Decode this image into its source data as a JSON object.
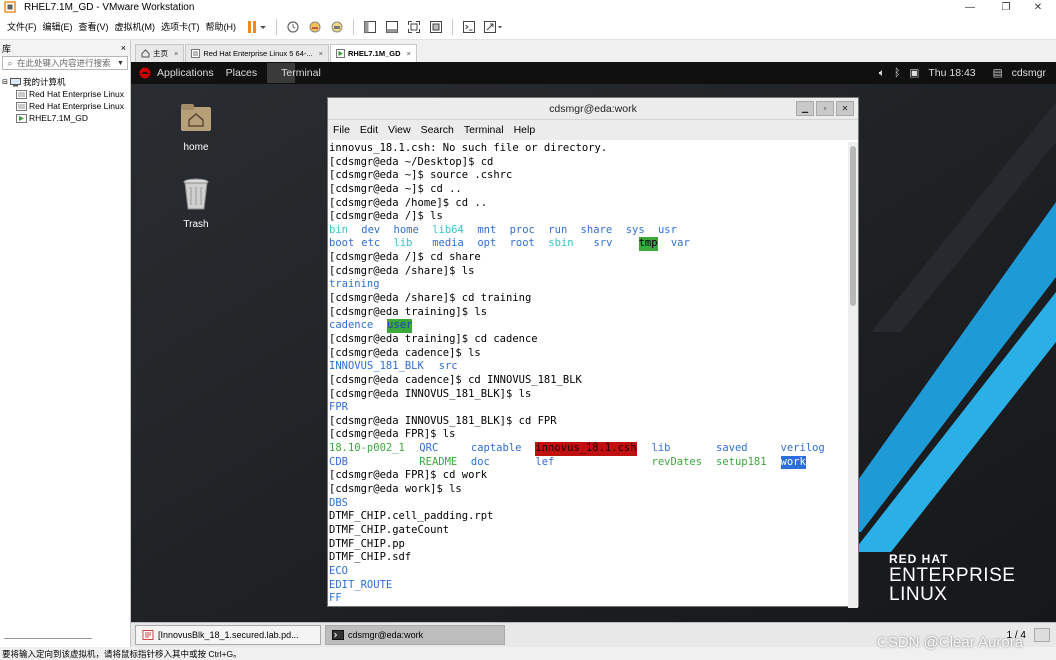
{
  "window": {
    "title": "RHEL7.1M_GD - VMware Workstation"
  },
  "menubar": {
    "items": [
      "文件(F)",
      "编辑(E)",
      "查看(V)",
      "虚拟机(M)",
      "选项卡(T)",
      "帮助(H)"
    ]
  },
  "library": {
    "title": "库",
    "close": "×",
    "search_placeholder": "在此处键入内容进行搜索",
    "tree": [
      {
        "label": "我的计算机",
        "level": 0
      },
      {
        "label": "Red Hat Enterprise Linux",
        "level": 1
      },
      {
        "label": "Red Hat Enterprise Linux",
        "level": 1
      },
      {
        "label": "RHEL7.1M_GD",
        "level": 1
      }
    ]
  },
  "tabs": [
    {
      "label": "主页",
      "active": false
    },
    {
      "label": "Red Hat Enterprise Linux 5 64-...",
      "active": false
    },
    {
      "label": "RHEL7.1M_GD",
      "active": true
    }
  ],
  "tab_close": "×",
  "gnome": {
    "applications": "Applications",
    "places": "Places",
    "terminal": "Terminal",
    "clock": "Thu 18:43",
    "user": "cdsmgr"
  },
  "desktop": {
    "home_label": "home",
    "trash_label": "Trash"
  },
  "branding": {
    "line1": "RED HAT",
    "line2": "ENTERPRISE",
    "line3": "LINUX"
  },
  "terminal": {
    "title": "cdsmgr@eda:work",
    "menu": [
      "File",
      "Edit",
      "View",
      "Search",
      "Terminal",
      "Help"
    ],
    "lines": [
      [
        {
          "t": "innovus_18.1.csh: No such file or directory.",
          "c": 0
        }
      ],
      [
        {
          "t": "[cdsmgr@eda ~/Desktop]$ cd",
          "c": 0
        }
      ],
      [
        {
          "t": "[cdsmgr@eda ~]$ source .cshrc",
          "c": 0
        }
      ],
      [
        {
          "t": "[cdsmgr@eda ~]$ cd ..",
          "c": 0
        }
      ],
      [
        {
          "t": "[cdsmgr@eda /home]$ cd ..",
          "c": 0
        }
      ],
      [
        {
          "t": "[cdsmgr@eda /]$ ls",
          "c": 0
        }
      ],
      [
        {
          "t": "bin",
          "c": 0,
          "k": "lnk"
        },
        {
          "t": "dev",
          "c": 5,
          "k": "dir"
        },
        {
          "t": "home",
          "c": 10,
          "k": "dir"
        },
        {
          "t": "lib64",
          "c": 16,
          "k": "lnk"
        },
        {
          "t": "mnt",
          "c": 23,
          "k": "dir"
        },
        {
          "t": "proc",
          "c": 28,
          "k": "dir"
        },
        {
          "t": "run",
          "c": 34,
          "k": "dir"
        },
        {
          "t": "share",
          "c": 39,
          "k": "dir"
        },
        {
          "t": "sys",
          "c": 46,
          "k": "dir"
        },
        {
          "t": "usr",
          "c": 51,
          "k": "dir"
        }
      ],
      [
        {
          "t": "boot",
          "c": 0,
          "k": "dir"
        },
        {
          "t": "etc",
          "c": 5,
          "k": "dir"
        },
        {
          "t": "lib",
          "c": 10,
          "k": "lnk"
        },
        {
          "t": "media",
          "c": 16,
          "k": "dir"
        },
        {
          "t": "opt",
          "c": 23,
          "k": "dir"
        },
        {
          "t": "root",
          "c": 28,
          "k": "dir"
        },
        {
          "t": "sbin",
          "c": 34,
          "k": "lnk"
        },
        {
          "t": "srv",
          "c": 41,
          "k": "dir"
        },
        {
          "t": "tmp",
          "c": 48,
          "k": "hl-green"
        },
        {
          "t": "var",
          "c": 53,
          "k": "dir"
        }
      ],
      [
        {
          "t": "[cdsmgr@eda /]$ cd share",
          "c": 0
        }
      ],
      [
        {
          "t": "[cdsmgr@eda /share]$ ls",
          "c": 0
        }
      ],
      [
        {
          "t": "training",
          "c": 0,
          "k": "dir"
        }
      ],
      [
        {
          "t": "[cdsmgr@eda /share]$ cd training",
          "c": 0
        }
      ],
      [
        {
          "t": "[cdsmgr@eda training]$ ls",
          "c": 0
        }
      ],
      [
        {
          "t": "cadence",
          "c": 0,
          "k": "dir"
        },
        {
          "t": "user",
          "c": 9,
          "k": "hl-green-blue"
        }
      ],
      [
        {
          "t": "[cdsmgr@eda training]$ cd cadence",
          "c": 0
        }
      ],
      [
        {
          "t": "[cdsmgr@eda cadence]$ ls",
          "c": 0
        }
      ],
      [
        {
          "t": "INNOVUS_181_BLK",
          "c": 0,
          "k": "dir"
        },
        {
          "t": "src",
          "c": 17,
          "k": "dir"
        }
      ],
      [
        {
          "t": "[cdsmgr@eda cadence]$ cd INNOVUS_181_BLK",
          "c": 0
        }
      ],
      [
        {
          "t": "[cdsmgr@eda INNOVUS_181_BLK]$ ls",
          "c": 0
        }
      ],
      [
        {
          "t": "FPR",
          "c": 0,
          "k": "dir"
        }
      ],
      [
        {
          "t": "[cdsmgr@eda INNOVUS_181_BLK]$ cd FPR",
          "c": 0
        }
      ],
      [
        {
          "t": "[cdsmgr@eda FPR]$ ls",
          "c": 0
        }
      ],
      [
        {
          "t": "18.10-p002_1",
          "c": 0,
          "k": "execg"
        },
        {
          "t": "QRC",
          "c": 14,
          "k": "dir"
        },
        {
          "t": "captable",
          "c": 22,
          "k": "dir"
        },
        {
          "t": "innovus_18.1.csh",
          "c": 32,
          "k": "hl-red"
        },
        {
          "t": "lib",
          "c": 50,
          "k": "dir"
        },
        {
          "t": "saved",
          "c": 60,
          "k": "dir"
        },
        {
          "t": "verilog",
          "c": 70,
          "k": "dir"
        }
      ],
      [
        {
          "t": "CDB",
          "c": 0,
          "k": "dir"
        },
        {
          "t": "README",
          "c": 14,
          "k": "execg"
        },
        {
          "t": "doc",
          "c": 22,
          "k": "dir"
        },
        {
          "t": "lef",
          "c": 32,
          "k": "dir"
        },
        {
          "t": "revDates",
          "c": 50,
          "k": "execg"
        },
        {
          "t": "setup181",
          "c": 60,
          "k": "execg"
        },
        {
          "t": "work",
          "c": 70,
          "k": "hl-blue"
        }
      ],
      [
        {
          "t": "[cdsmgr@eda FPR]$ cd work",
          "c": 0
        }
      ],
      [
        {
          "t": "[cdsmgr@eda work]$ ls",
          "c": 0
        }
      ],
      [
        {
          "t": "DBS",
          "c": 0,
          "k": "dir"
        }
      ],
      [
        {
          "t": "DTMF_CHIP.cell_padding.rpt",
          "c": 0
        }
      ],
      [
        {
          "t": "DTMF_CHIP.gateCount",
          "c": 0
        }
      ],
      [
        {
          "t": "DTMF_CHIP.pp",
          "c": 0
        }
      ],
      [
        {
          "t": "DTMF_CHIP.sdf",
          "c": 0
        }
      ],
      [
        {
          "t": "ECO",
          "c": 0,
          "k": "dir"
        }
      ],
      [
        {
          "t": "EDIT_ROUTE",
          "c": 0,
          "k": "dir"
        }
      ],
      [
        {
          "t": "FF",
          "c": 0,
          "k": "dir"
        }
      ]
    ]
  },
  "guest_taskbar": {
    "tasks": [
      {
        "label": "[InnovusBlk_18_1.secured.lab.pd...",
        "active": false
      },
      {
        "label": "cdsmgr@eda:work",
        "active": true
      }
    ],
    "pager": "1 / 4"
  },
  "status_bar": {
    "text": "要将输入定向到该虚拟机，请将鼠标指针移入其中或按 Ctrl+G。"
  },
  "watermark": "CSDN @Clear Aurora"
}
